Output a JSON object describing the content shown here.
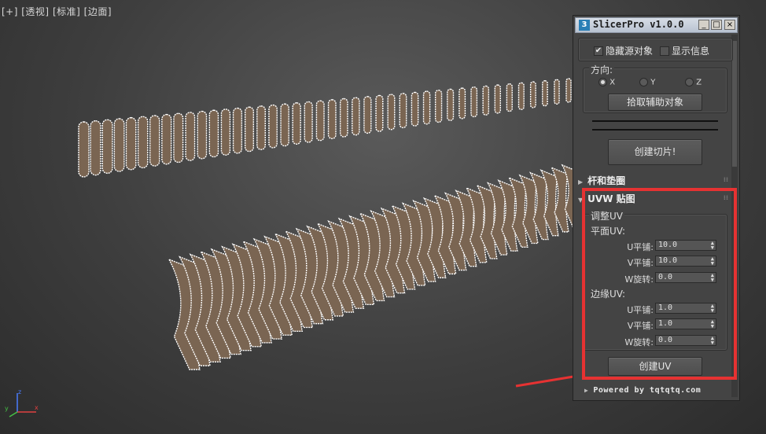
{
  "viewport": {
    "plus": "[+]",
    "view": "[透视]",
    "shading": "[标准]",
    "edges": "[边面]"
  },
  "panel": {
    "title": "SlicerPro v1.0.0",
    "title_icon": "3",
    "window_buttons": {
      "minimize": "_",
      "maximize": "□",
      "close": "×"
    },
    "hide_source_label": "隐藏源对象",
    "hide_source_checked": true,
    "show_info_label": "显示信息",
    "show_info_checked": false,
    "direction_label": "方向:",
    "axes": [
      {
        "label": "X",
        "selected": true
      },
      {
        "label": "Y",
        "selected": false
      },
      {
        "label": "Z",
        "selected": false
      }
    ],
    "pick_helper_button": "拾取辅助对象",
    "create_slices_button": "创建切片!",
    "rollout_rods": "杆和垫圈",
    "rollout_uvw": "UVW 贴图",
    "adjust_uv_label": "调整UV",
    "planar_uv_label": "平面UV:",
    "edge_uv_label": "边缘UV:",
    "planar": {
      "u_tile_label": "U平铺:",
      "u_tile": "10.0",
      "v_tile_label": "V平铺:",
      "v_tile": "10.0",
      "w_rot_label": "W旋转:",
      "w_rot": "0.0"
    },
    "edge": {
      "u_tile_label": "U平铺:",
      "u_tile": "1.0",
      "v_tile_label": "V平铺:",
      "v_tile": "1.0",
      "w_rot_label": "W旋转:",
      "w_rot": "0.0"
    },
    "create_uv_button": "创建UV",
    "footer": "Powered by tqtqtq.com"
  },
  "colors": {
    "highlight": "#e63232",
    "panel_bg": "#444444",
    "slat_fill": "#7a6552",
    "slat_edge": "#ffffff"
  },
  "icons": [
    "checkbox-icon",
    "radio-icon",
    "rollout-arrow-icon",
    "spinner-arrows-icon",
    "pointer-arrow-icon",
    "axis-gizmo-icon"
  ]
}
